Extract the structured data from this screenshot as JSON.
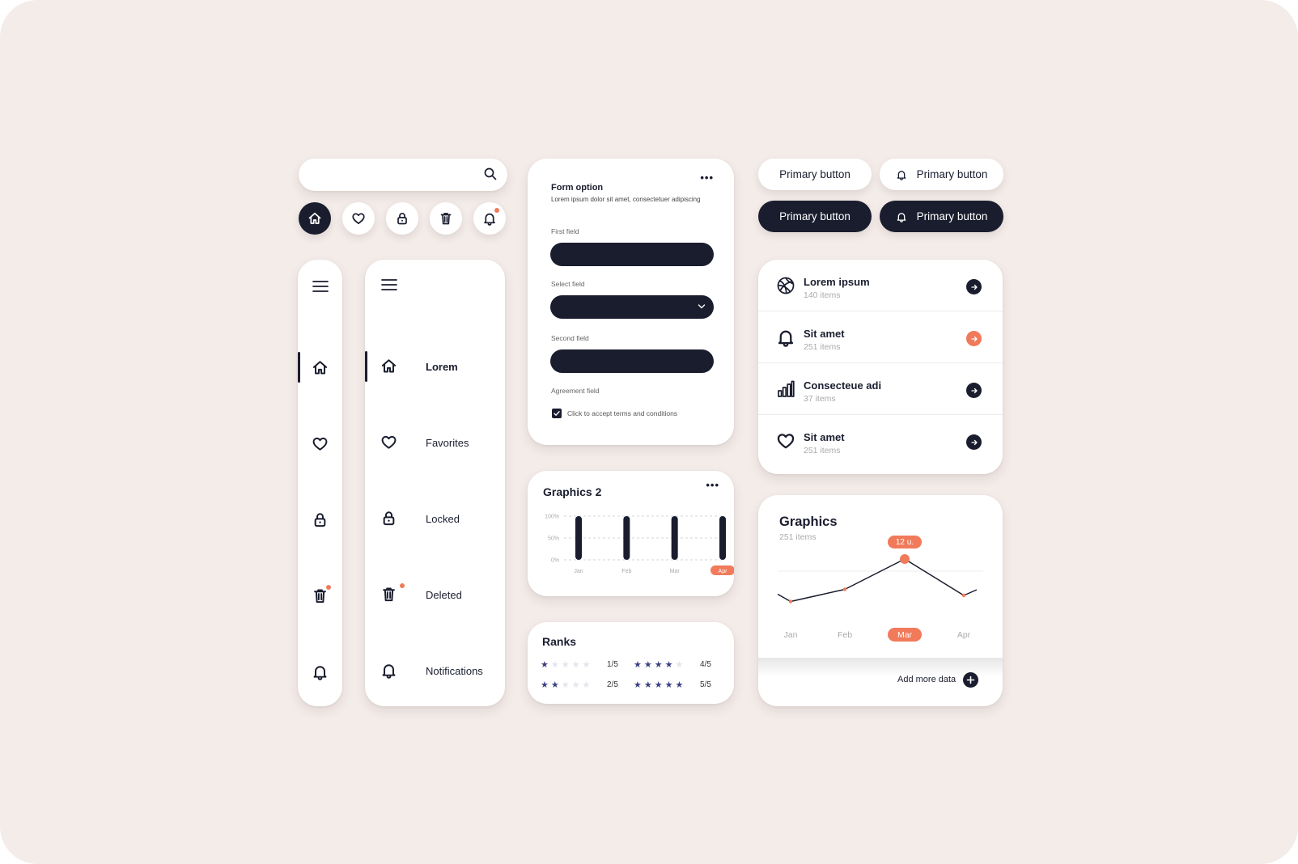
{
  "search": {
    "placeholder": ""
  },
  "icon_buttons": [
    {
      "name": "home",
      "active": true
    },
    {
      "name": "heart",
      "active": false
    },
    {
      "name": "lock",
      "active": false
    },
    {
      "name": "trash",
      "active": false
    },
    {
      "name": "bell",
      "active": false,
      "badge": true
    }
  ],
  "nav": {
    "items": [
      {
        "label": "Lorem",
        "icon": "home-icon",
        "active": true
      },
      {
        "label": "Favorites",
        "icon": "heart-icon",
        "active": false
      },
      {
        "label": "Locked",
        "icon": "lock-icon",
        "active": false
      },
      {
        "label": "Deleted",
        "icon": "trash-icon",
        "active": false,
        "badge": true
      },
      {
        "label": "Notifications",
        "icon": "bell-icon",
        "active": false
      }
    ]
  },
  "form": {
    "title": "Form option",
    "subtitle": "Lorem ipsum dolor sit amet, consectetuer adipiscing",
    "first_label": "First field",
    "select_label": "Select field",
    "second_label": "Second field",
    "agreement_label": "Agreement field",
    "checkbox_label": "Click to accept terms and conditions",
    "checkbox_checked": true,
    "more": "•••"
  },
  "graphics2": {
    "title": "Graphics 2",
    "more": "•••",
    "chart_data": {
      "type": "bar",
      "categories": [
        "Jan",
        "Feb",
        "Mar",
        "Apr"
      ],
      "yticks": [
        "100%",
        "50%",
        "0%"
      ],
      "ylim": [
        0,
        100
      ],
      "values": [
        100,
        100,
        100,
        100
      ],
      "highlight": "Apr"
    }
  },
  "ranks": {
    "title": "Ranks",
    "items": [
      {
        "stars": 1,
        "label": "1/5"
      },
      {
        "stars": 2,
        "label": "2/5"
      },
      {
        "stars": 4,
        "label": "4/5"
      },
      {
        "stars": 5,
        "label": "5/5"
      }
    ]
  },
  "buttons": {
    "light_plain": "Primary button",
    "light_icon": "Primary button",
    "dark_plain": "Primary button",
    "dark_icon": "Primary button"
  },
  "list": {
    "items": [
      {
        "title": "Lorem ipsum",
        "sub": "140 items",
        "icon": "basketball-icon",
        "accent": false
      },
      {
        "title": "Sit amet",
        "sub": "251 items",
        "icon": "bell-icon",
        "accent": true
      },
      {
        "title": "Consecteue adi",
        "sub": "37 items",
        "icon": "bar-chart-icon",
        "accent": false
      },
      {
        "title": "Sit amet",
        "sub": "251 items",
        "icon": "heart-icon",
        "accent": false
      }
    ]
  },
  "graphics": {
    "title": "Graphics",
    "sub": "251 items",
    "add_label": "Add more data",
    "chart_data": {
      "type": "line",
      "categories": [
        "Jan",
        "Feb",
        "Mar",
        "Apr"
      ],
      "values": [
        3,
        5,
        10,
        4
      ],
      "ylim": [
        0,
        12
      ],
      "highlight": "Mar",
      "annotation": "12 u."
    }
  },
  "colors": {
    "ink": "#1a1d2e",
    "accent": "#f07a5a",
    "star": "#3b3f80",
    "background": "#f4ece9"
  }
}
